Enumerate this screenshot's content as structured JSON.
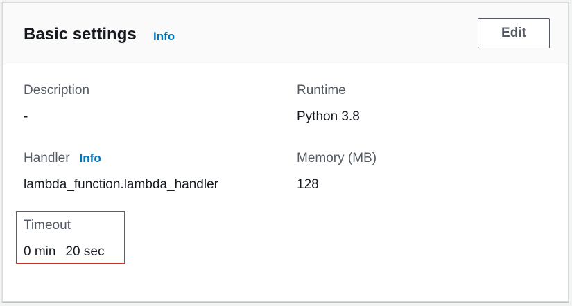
{
  "panel": {
    "title": "Basic settings",
    "info_label": "Info",
    "edit_label": "Edit"
  },
  "fields": {
    "description": {
      "label": "Description",
      "value": "-"
    },
    "runtime": {
      "label": "Runtime",
      "value": "Python 3.8"
    },
    "handler": {
      "label": "Handler",
      "info_label": "Info",
      "value": "lambda_function.lambda_handler"
    },
    "memory": {
      "label": "Memory (MB)",
      "value": "128"
    },
    "timeout": {
      "label": "Timeout",
      "minutes": "0 min",
      "seconds": "20 sec"
    }
  },
  "colors": {
    "link": "#0073bb",
    "highlight": "#c7352c",
    "label": "#545b64",
    "text": "#16191f"
  }
}
